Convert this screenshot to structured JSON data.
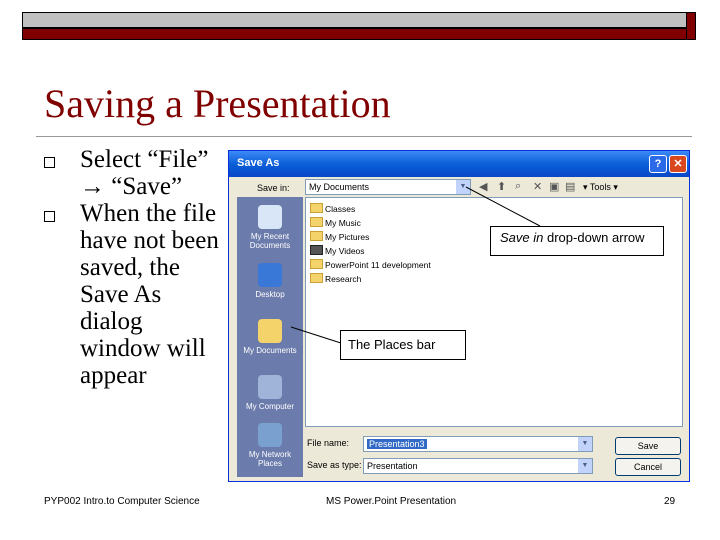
{
  "slide": {
    "title": "Saving a Presentation",
    "bullets": [
      "Select “File” → “Save”",
      "When the file have not been saved, the Save As dialog window will appear"
    ],
    "callouts": {
      "save_in_prefix": "Save in",
      "save_in_suffix": " drop-down arrow",
      "places_bar": "The Places bar"
    },
    "footer": {
      "left": "PYP002 Intro.to Computer Science",
      "center": "MS Power.Point Presentation",
      "page": "29"
    }
  },
  "dialog": {
    "title": "Save As",
    "help": "?",
    "close": "✕",
    "save_in_label": "Save in:",
    "save_in_value": "My Documents",
    "tools_label": "Tools",
    "places": [
      "My Recent Documents",
      "Desktop",
      "My Documents",
      "My Computer",
      "My Network Places"
    ],
    "folders": [
      "Classes",
      "My Music",
      "My Pictures",
      "My Videos",
      "PowerPoint 11 development",
      "Research"
    ],
    "file_name_label": "File name:",
    "file_name_value": "Presentation3",
    "save_as_type_label": "Save as type:",
    "save_as_type_value": "Presentation",
    "save_button": "Save",
    "cancel_button": "Cancel"
  },
  "colors": {
    "accent": "#800000",
    "title_bar": "#0a5fd8",
    "places_bar": "#6b7bab"
  }
}
